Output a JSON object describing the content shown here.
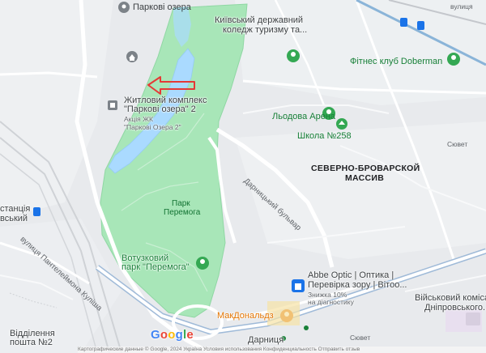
{
  "labels": {
    "parkovi_ozera": "Паркові озера",
    "kyiv_college_1": "Київський державний",
    "kyiv_college_2": "коледж туризму та...",
    "fitness": "Фітнес клуб Doberman",
    "zhytlovyi_1": "Житловий комплекс",
    "zhytlovyi_2": "\"Паркові озера\" 2",
    "akcia_1": "Акція ЖК",
    "akcia_2": "\"Паркові Озера 2\"",
    "lodova_arena": "Льодова Арена",
    "school": "Школа №258",
    "district_1": "СЕВЕРНО-БРОВАРСКОЙ",
    "district_2": "МАССИВ",
    "bulvar": "Дарницький бульвар",
    "park_peremoha_1": "Парк",
    "park_peremoha_2": "Перемога",
    "votuzkovyi_1": "Вотузковий",
    "votuzkovyi_2": "парк \"Перемога\"",
    "station_1": "станція",
    "station_2": "вський",
    "pantel_street": "вулиця Пантелеймона Куліша",
    "abbe_1": "Abbe Optic | Оптика |",
    "abbe_2": "Перевірка зору | Вітоо...",
    "abbe_3": "Знижка 10%",
    "abbe_4": "на діагностику",
    "military_1": "Військовий комісаріат",
    "military_2": "Дніпровського...",
    "mcd": "МакДональдз",
    "darnytsia": "Дарниця",
    "viddilennia_1": "Відділення",
    "viddilennia_2": "пошта №2",
    "syuvet": "Сювет",
    "syuvet2": "Сювет",
    "topright": "вулиця",
    "footer": "Картографические данные © Google, 2024   Україна   Условия использования   Конфиденциальность   Отправить отзыв"
  },
  "logo": [
    "G",
    "o",
    "o",
    "g",
    "l",
    "e"
  ],
  "colors": {
    "park": "#a8e6b8",
    "park_border": "#8fd7a3",
    "water": "#aadaff",
    "road_major": "#ffffff",
    "road_minor": "#f8f9fa",
    "rail": "#c4c7cc",
    "arrow": "#e53935",
    "blue_road": "#8ab4d8"
  }
}
